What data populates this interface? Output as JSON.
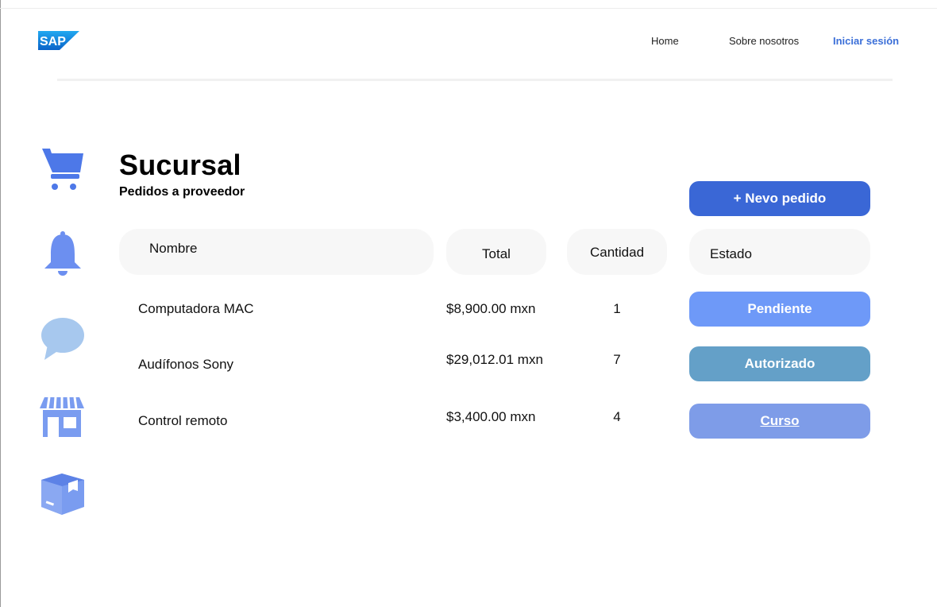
{
  "brand": {
    "logo_text": "SAP"
  },
  "nav": {
    "home": "Home",
    "about": "Sobre nosotros",
    "login": "Iniciar sesión"
  },
  "sidebar": {
    "icons": [
      "cart-icon",
      "bell-icon",
      "chat-icon",
      "store-icon",
      "box-icon"
    ]
  },
  "page": {
    "title": "Sucursal",
    "subtitle": "Pedidos a proveedor"
  },
  "actions": {
    "new_order": "+ Nevo pedido"
  },
  "table": {
    "headers": {
      "name": "Nombre",
      "total": "Total",
      "qty": "Cantidad",
      "status": "Estado"
    },
    "rows": [
      {
        "name": "Computadora MAC",
        "total": "$8,900.00 mxn",
        "qty": "1",
        "status": "Pendiente",
        "status_color": "#6e99f8"
      },
      {
        "name": "Audífonos Sony",
        "total": "$29,012.01 mxn",
        "qty": "7",
        "status": "Autorizado",
        "status_color": "#64a0c8"
      },
      {
        "name": "Control remoto",
        "total": "$3,400.00 mxn",
        "qty": "4",
        "status": "Curso",
        "status_color": "#7e9ce8"
      }
    ]
  },
  "colors": {
    "accent": "#3a67d6",
    "nav_login": "#3b6fd8",
    "icon_blue": "#4d78e8",
    "icon_light": "#8fb1e6"
  }
}
